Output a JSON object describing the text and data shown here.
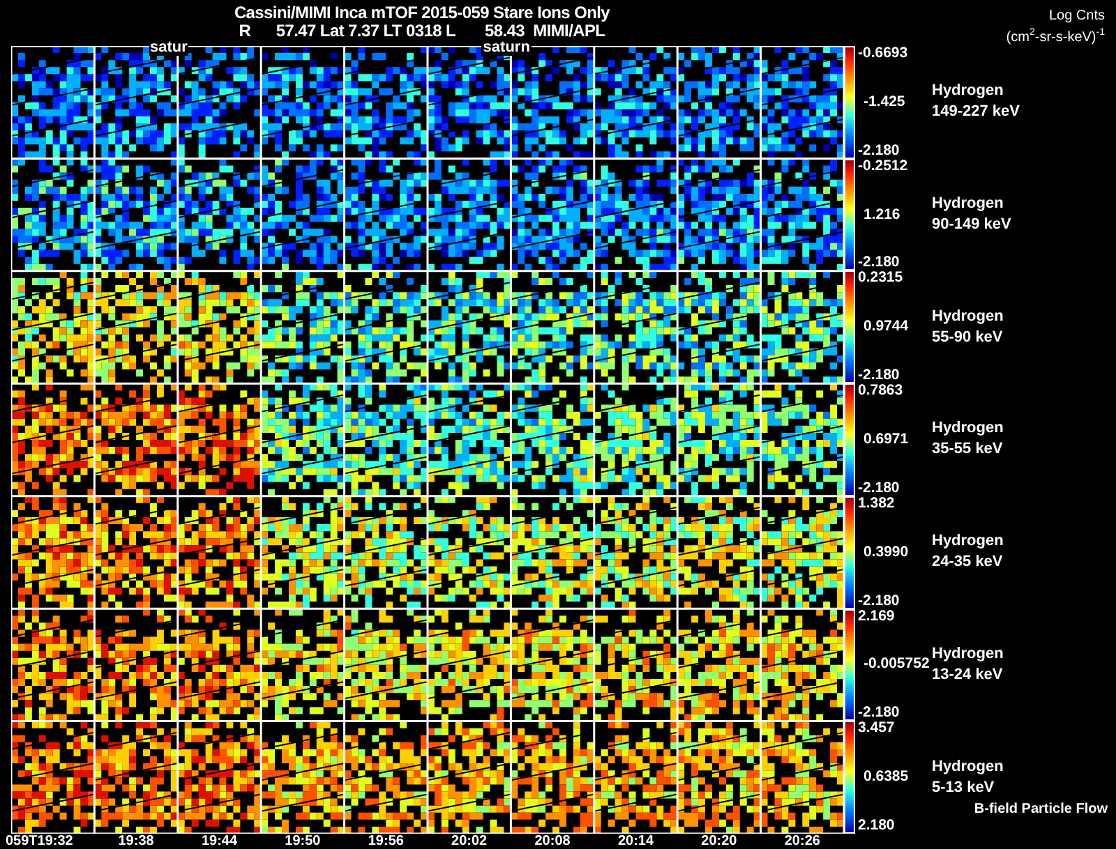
{
  "title": "Cassini/MIMI Inca mTOF  2015-059   Stare   Ions Only",
  "subtitle": "R      57.47 Lat 7.37 LT 0318 L       58.43  MIMI/APL",
  "units_title": "Log Cnts",
  "units": "(cm$^{2}$-sr-s-keV)$^{-1}$",
  "columns": [
    {
      "time": "059T19:32"
    },
    {
      "time": "19:38",
      "label": "satur"
    },
    {
      "time": "19:44"
    },
    {
      "time": "19:50"
    },
    {
      "time": "19:56"
    },
    {
      "time": "20:02",
      "label": "saturn"
    },
    {
      "time": "20:08"
    },
    {
      "time": "20:14"
    },
    {
      "time": "20:20"
    },
    {
      "time": "20:26"
    }
  ],
  "rows": [
    {
      "species": "Hydrogen",
      "energy": "149-227 keV",
      "max": "-0.6693",
      "mid": "-1.425",
      "min": "-2.180"
    },
    {
      "species": "Hydrogen",
      "energy": "90-149 keV",
      "max": "-0.2512",
      "mid": "1.216",
      "min": "-2.180"
    },
    {
      "species": "Hydrogen",
      "energy": "55-90 keV",
      "max": "0.2315",
      "mid": "0.9744",
      "min": "-2.180"
    },
    {
      "species": "Hydrogen",
      "energy": "35-55 keV",
      "max": "0.7863",
      "mid": "0.6971",
      "min": "-2.180"
    },
    {
      "species": "Hydrogen",
      "energy": "24-35 keV",
      "max": "1.382",
      "mid": "0.3990",
      "min": "-2.180"
    },
    {
      "species": "Hydrogen",
      "energy": "13-24 keV",
      "max": "2.169",
      "mid": "-0.005752",
      "min": "-2.180"
    },
    {
      "species": "Hydrogen",
      "energy": "5-13 keV",
      "max": "3.457",
      "mid": "0.6385",
      "min": "2.180"
    }
  ],
  "footnote": "B-field Particle Flow"
}
